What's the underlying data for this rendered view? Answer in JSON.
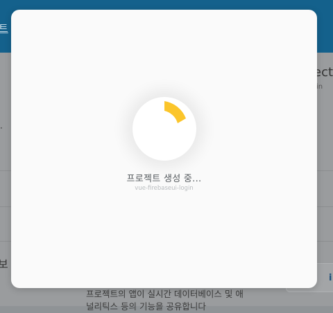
{
  "background": {
    "topbar_text": "트",
    "right_title": "ect-",
    "right_sub": "in",
    "left_text": "보",
    "right_button_label": "i",
    "bottom_text_line1": "프로젝트의 앱이 실시간 데이터베이스 및 애",
    "bottom_text_line2": "널리틱스 등의 기능을 공유합니다"
  },
  "modal": {
    "status_title": "프로젝트 생성 중...",
    "project_id": "vue-firebaseui-login",
    "spinner": {
      "accent_color": "#fbc52b",
      "state": "loading"
    }
  }
}
